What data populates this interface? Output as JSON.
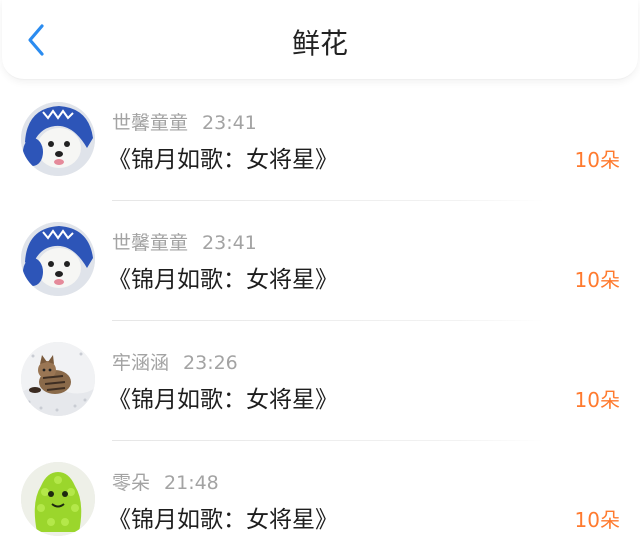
{
  "header": {
    "title": "鲜花",
    "back_icon": "chevron-left-icon",
    "accent_color": "#2b8cf0"
  },
  "list": {
    "items": [
      {
        "avatar": "dog-in-blue-hat-avatar",
        "user": "世馨童童",
        "time": "23:41",
        "book": "《锦月如歌：女将星》",
        "count": "10朵"
      },
      {
        "avatar": "dog-in-blue-hat-avatar",
        "user": "世馨童童",
        "time": "23:41",
        "book": "《锦月如歌：女将星》",
        "count": "10朵"
      },
      {
        "avatar": "cat-on-bed-avatar",
        "user": "牢涵涵",
        "time": "23:26",
        "book": "《锦月如歌：女将星》",
        "count": "10朵"
      },
      {
        "avatar": "green-monster-toy-avatar",
        "user": "零朵",
        "time": "21:48",
        "book": "《锦月如歌：女将星》",
        "count": "10朵"
      }
    ]
  },
  "colors": {
    "count": "#ff7a2e",
    "username": "#a3a3a3",
    "book": "#1e1e1e"
  }
}
